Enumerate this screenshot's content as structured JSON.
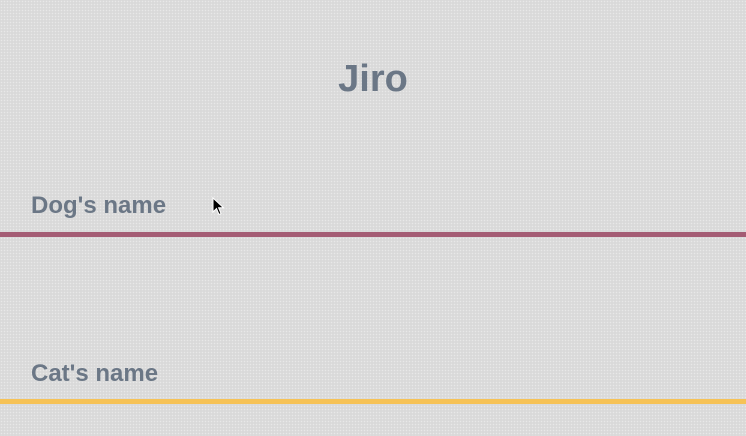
{
  "title": "Jiro",
  "fields": {
    "dog": {
      "label": "Dog's name",
      "value": ""
    },
    "cat": {
      "label": "Cat's name",
      "value": ""
    }
  },
  "colors": {
    "background": "#dcdcdc",
    "text": "#6b7786",
    "dog_accent": "#a45c74",
    "cat_accent": "#f6c256"
  },
  "icons": {
    "pointer": "mouse-pointer-icon"
  }
}
